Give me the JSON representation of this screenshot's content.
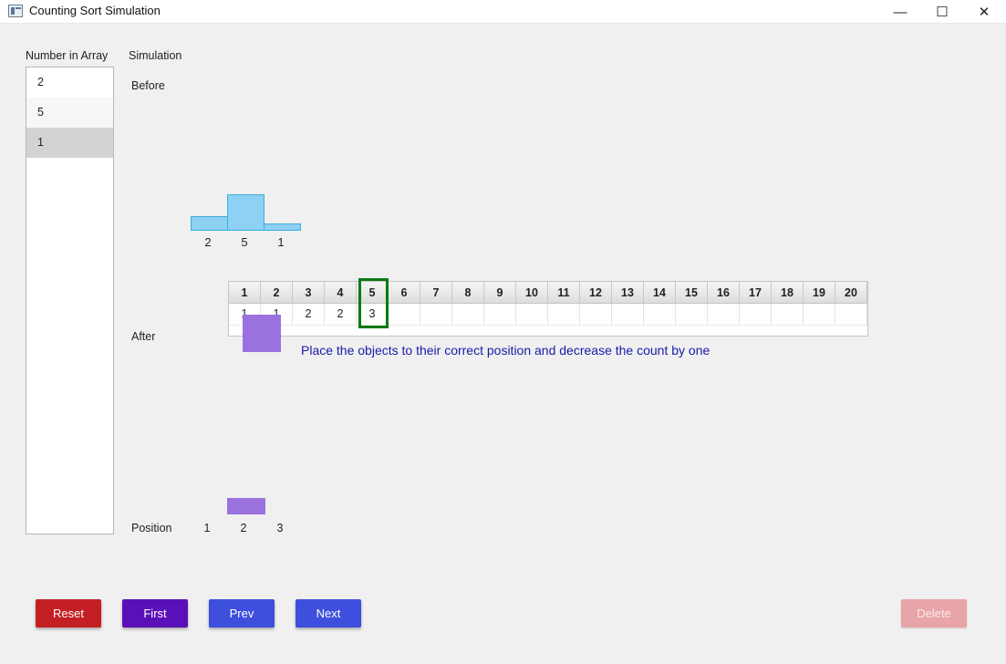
{
  "window": {
    "title": "Counting Sort Simulation",
    "minimize": "—",
    "maximize": "☐",
    "close": "✕"
  },
  "labels": {
    "number_in_array": "Number in Array",
    "simulation": "Simulation",
    "before": "Before",
    "after": "After",
    "position": "Position"
  },
  "array_list": [
    "2",
    "5",
    "1"
  ],
  "selected_index": 2,
  "before_chart": {
    "values": [
      2,
      5,
      1
    ],
    "labels": [
      "2",
      "5",
      "1"
    ],
    "color": "#8fd0f5"
  },
  "count_table": {
    "headers": [
      "1",
      "2",
      "3",
      "4",
      "5",
      "6",
      "7",
      "8",
      "9",
      "10",
      "11",
      "12",
      "13",
      "14",
      "15",
      "16",
      "17",
      "18",
      "19",
      "20"
    ],
    "counts": [
      "1",
      "1",
      "2",
      "2",
      "3",
      "",
      "",
      "",
      "",
      "",
      "",
      "",
      "",
      "",
      "",
      "",
      "",
      "",
      "",
      ""
    ],
    "highlighted_column": 5
  },
  "message": "Place the objects to their correct position and decrease the count by one",
  "positions": [
    "1",
    "2",
    "3"
  ],
  "buttons": {
    "reset": "Reset",
    "first": "First",
    "prev": "Prev",
    "next": "Next",
    "delete": "Delete"
  },
  "colors": {
    "reset": "#c41f24",
    "first": "#5a10b8",
    "prev": "#3d4fdc",
    "next": "#3d4fdc",
    "delete_disabled": "#e8a4a8",
    "moving_object": "#9b72dd",
    "highlight": "#0a7a12",
    "message": "#1a1aa8"
  }
}
